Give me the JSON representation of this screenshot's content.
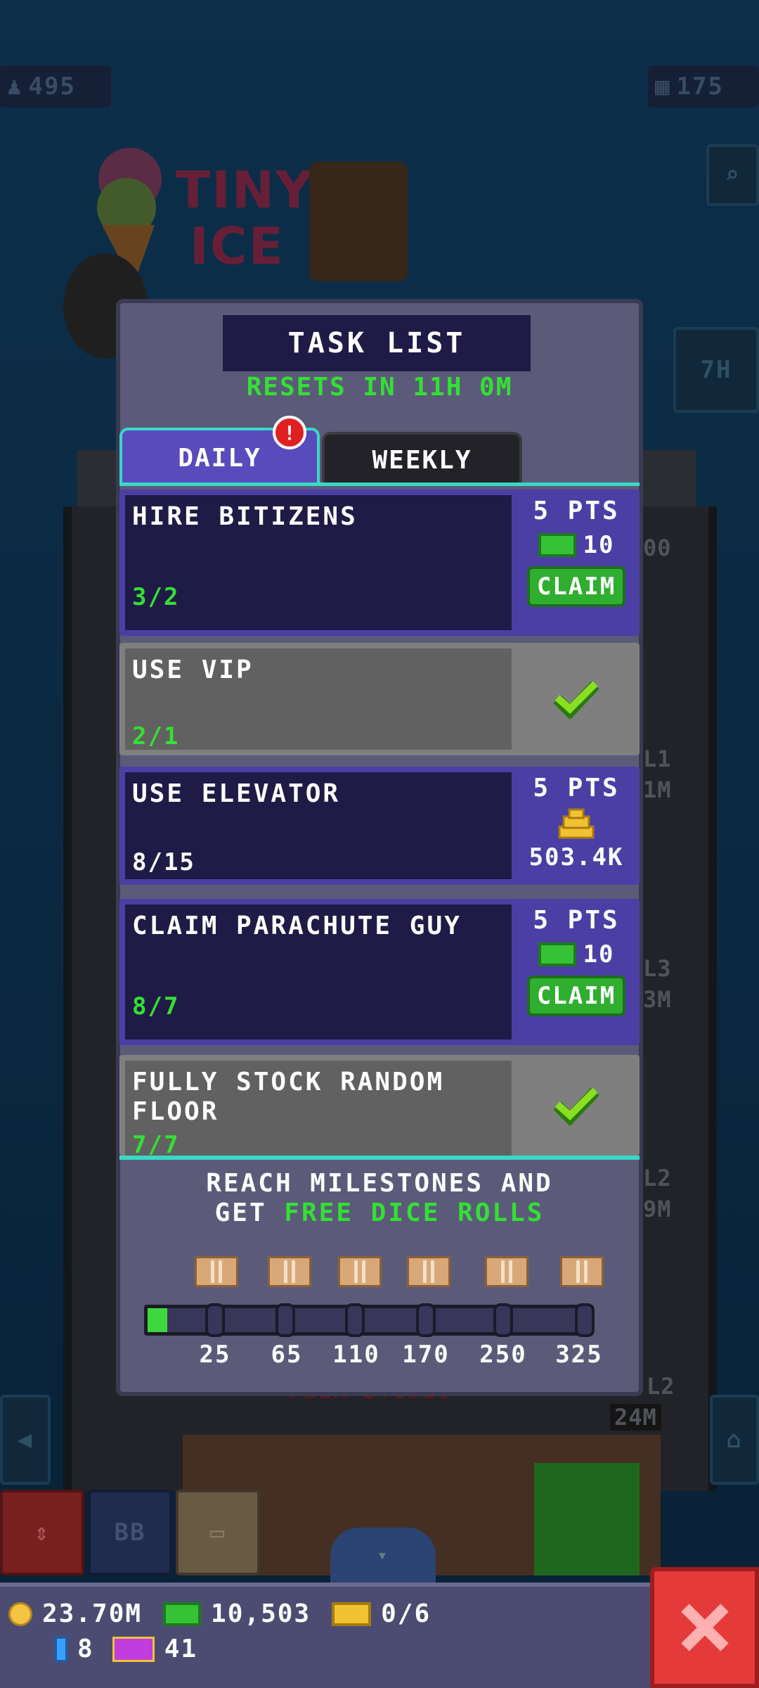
{
  "hud_top": {
    "population": "495",
    "floors": "175",
    "timer_badge": "7H"
  },
  "background_labels": {
    "sign_line1": "TINY",
    "sign_line2": "ICE",
    "floor_tags": [
      "00",
      "L1",
      "1M",
      "L3",
      "3M",
      "L2",
      "9M",
      "L2",
      "24M"
    ],
    "studio": "FILM STUDIO"
  },
  "modal": {
    "title": "TASK LIST",
    "resets": "RESETS IN 11H 0M",
    "tabs": [
      {
        "label": "DAILY",
        "active": true,
        "alert": "!"
      },
      {
        "label": "WEEKLY",
        "active": false
      }
    ],
    "tasks": [
      {
        "name": "HIRE BITIZENS",
        "progress": "3/2",
        "completed": false,
        "points": "5 PTS",
        "reward_icon": "bux-icon",
        "reward": "10",
        "claim": "CLAIM"
      },
      {
        "name": "USE VIP",
        "progress": "2/1",
        "completed": true
      },
      {
        "name": "USE ELEVATOR",
        "progress": "8/15",
        "completed": false,
        "points": "5 PTS",
        "reward_icon": "coin-stack-icon",
        "reward": "503.4K"
      },
      {
        "name": "CLAIM PARACHUTE GUY",
        "progress": "8/7",
        "completed": false,
        "points": "5 PTS",
        "reward_icon": "bux-icon",
        "reward": "10",
        "claim": "CLAIM"
      },
      {
        "name": "FULLY STOCK RANDOM FLOOR",
        "progress": "7/7",
        "completed": true
      }
    ],
    "milestones": {
      "line1": "REACH MILESTONES AND",
      "line2_prefix": "GET ",
      "line2_highlight": "FREE DICE ROLLS",
      "values": [
        "25",
        "65",
        "110",
        "170",
        "250",
        "325"
      ],
      "progress_fraction": 0.045
    }
  },
  "bottom_bar": {
    "elevator_label": "BB",
    "coins": "23.70M",
    "bux": "10,503",
    "tickets": "0/6",
    "gems": "8",
    "vip": "41"
  },
  "colors": {
    "accent_green": "#33e033",
    "tab_teal": "#39d8c8",
    "purple": "#4b3fa5",
    "close_red": "#e53a3a"
  }
}
